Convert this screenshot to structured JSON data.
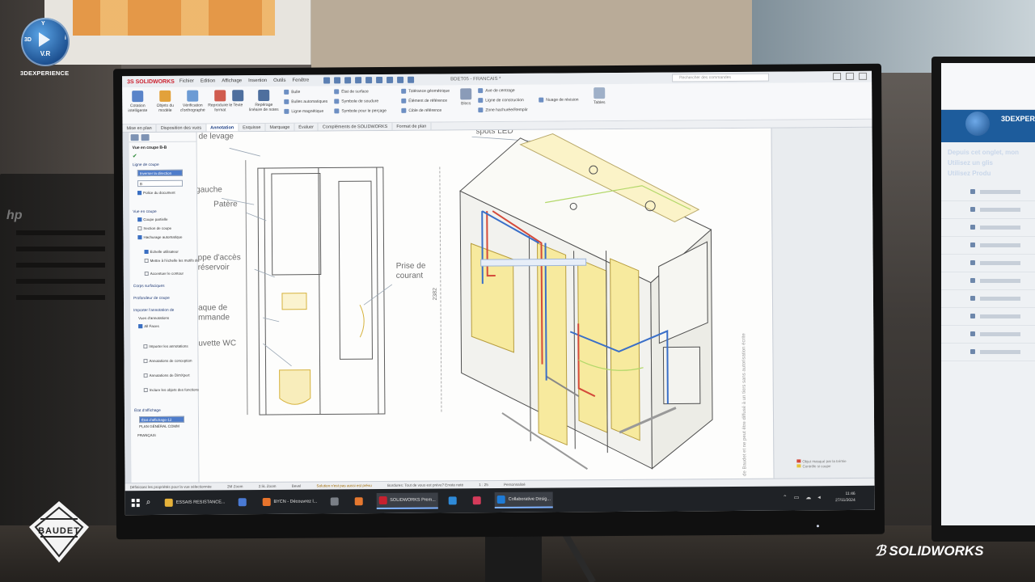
{
  "overlay": {
    "vr_badge": {
      "top": "Y",
      "left": "3D",
      "right": "i",
      "bottom": "V.R"
    },
    "platform_text": "3DEXPERIENCE",
    "company_logo_text": "BAUDET",
    "brand_text": "SOLIDWORKS"
  },
  "app": {
    "brand": "3S SOLIDWORKS",
    "menu": [
      "Fichier",
      "Edition",
      "Affichage",
      "Insertion",
      "Outils",
      "Fenêtre"
    ],
    "document_title": "BDET05 - FRANCAIS *",
    "search_placeholder": "Rechercher des commandes"
  },
  "ribbon": {
    "large_buttons": [
      {
        "label": "Cotation intelligente",
        "color": "#5a84c9"
      },
      {
        "label": "Objets du modèle",
        "color": "#e2a13b"
      },
      {
        "label": "Vérification d'orthographe",
        "color": "#6c9bd4"
      },
      {
        "label": "Reproduire le format",
        "color": "#d05c4f"
      },
      {
        "label": "Texte",
        "color": "#4e6f9e"
      },
      {
        "label": "Repère",
        "color": "#6c9bd4"
      },
      {
        "label": "Repérage linéaire de notes",
        "color": "#4e6f9e"
      }
    ],
    "rows_col1": [
      "Bulle",
      "Bulles automatiques",
      "Ligne magnétique"
    ],
    "rows_col2": [
      "État de surface",
      "Symbole de soudure",
      "Symbole pour le perçage"
    ],
    "rows_col3": [
      "Tolérance géométrique",
      "Élément de référence",
      "Cible de référence"
    ],
    "rows_col4": [
      "Axe de centrage",
      "Ligne de construction",
      "Zone hachurée/Remplir"
    ],
    "blocs": "Blocs",
    "tables": "Tables",
    "revision": "Nuage de révision"
  },
  "command_tabs": [
    "Mise en plan",
    "Disposition des vues",
    "Annotation",
    "Esquisse",
    "Marquage",
    "Évaluer",
    "Compléments de SOLIDWORKS",
    "Format de plan"
  ],
  "command_tabs_active": 2,
  "panel": {
    "title": "Vue en coupe B-B",
    "group_line": "Ligne de coupe",
    "input_direction": "Inverser la direction",
    "input_label": "B",
    "checkbox_doc": "Police du document",
    "group_view": "Vue en coupe",
    "options": [
      {
        "label": "Coupe partielle",
        "on": true
      },
      {
        "label": "Section de coupe",
        "on": false
      },
      {
        "label": "Hachurage automatique",
        "on": true
      },
      {
        "label": "Echelle utilisateur",
        "on": true
      },
      {
        "label": "Mettre à l'échelle les motifs de hachures",
        "on": false
      },
      {
        "label": "Accentuer le contour",
        "on": false
      }
    ],
    "group_bodies": "Corps surfaciques",
    "group_depth": "Profondeur de coupe",
    "group_import": "Importer l'annotation de",
    "import_views": "Vues d'annotations",
    "import_rows": [
      {
        "label": "Importer les annotations",
        "on": false
      },
      {
        "label": "Annotations de conception",
        "on": false
      },
      {
        "label": "Annotations de DimXpert",
        "on": false
      },
      {
        "label": "Inclure les objets des fonctions cachées",
        "on": false
      }
    ],
    "all_faces": "All Faces",
    "group_display": "État d'affichage",
    "display_rows": [
      "État d'affichage-12",
      "PLAN GÉNÉRAL COMM"
    ],
    "language": "FRANÇAIS"
  },
  "drawing": {
    "callouts": [
      "de levage",
      "gauche",
      "Patère",
      "ppe d'accès",
      "réservoir",
      "aque de",
      "mmande",
      "uvette WC",
      "Prise de",
      "courant",
      "spots LED"
    ],
    "dimension": "2382",
    "vertical_note": "de Baudet et ne peut être diffusé à un tiers sans autorisation écrite",
    "legend": [
      "Objet masqué par la trémie",
      "Contrôle si coupe"
    ]
  },
  "statusbar": {
    "items": [
      "Définissez les propriétés pour la vue sélectionnée",
      "2M Zoom",
      "2.5L Zoom",
      "Bevel"
    ],
    "warning": "Solution n'est pas aussi est prévu",
    "extra": "Bordures: Tout de vous est prévu? Errata noté",
    "scale": "1 : 25",
    "units": "Personnalisé"
  },
  "taskbar": {
    "apps": [
      {
        "label": "ESSAIS RESISTANCE...",
        "color": "#e6b23a",
        "active": false
      },
      {
        "label": "",
        "color": "#4a7ad4",
        "active": false
      },
      {
        "label": "BYCN - Découvrez l...",
        "color": "#e8742c",
        "active": false
      },
      {
        "label": "",
        "color": "#7a7f86",
        "active": false
      },
      {
        "label": "",
        "color": "#e6782f",
        "active": false
      },
      {
        "label": "SOLIDWORKS Prem...",
        "color": "#c7212f",
        "active": true
      },
      {
        "label": "",
        "color": "#2e8ad8",
        "active": false
      },
      {
        "label": "",
        "color": "#d43b5a",
        "active": false
      },
      {
        "label": "Collaborative Desig...",
        "color": "#1e7bd6",
        "active": true
      }
    ],
    "time": "11:46",
    "date": "27/11/2024"
  },
  "second_monitor": {
    "brand": "3DEXPERIE",
    "heading": "Depuis cet onglet, mon",
    "bullets": [
      "Utilisez un glis",
      "Utilisez Produ"
    ]
  }
}
